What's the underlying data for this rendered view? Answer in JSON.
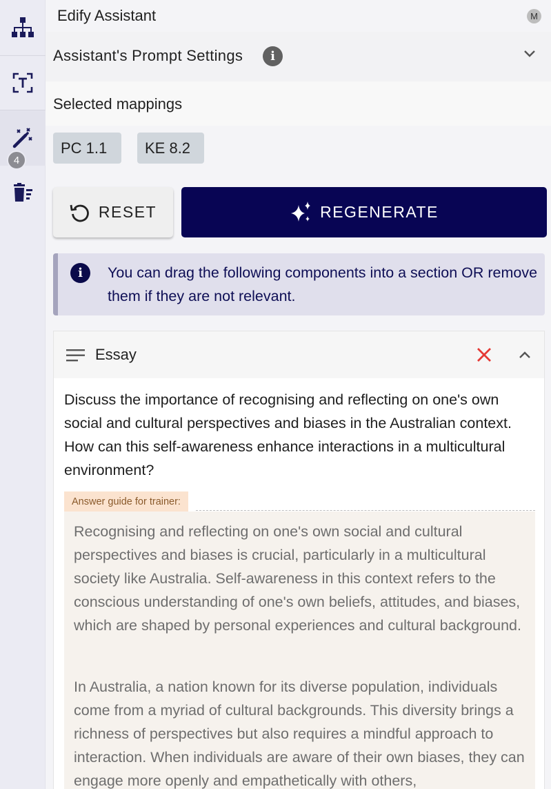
{
  "app": {
    "title": "Edify Assistant",
    "avatar_initial": "M"
  },
  "rail": {
    "badge_count": "4"
  },
  "settings": {
    "title": "Assistant's Prompt Settings"
  },
  "mappings": {
    "label": "Selected mappings",
    "chips": [
      "PC 1.1",
      "KE 8.2"
    ]
  },
  "actions": {
    "reset_label": "RESET",
    "regenerate_label": "REGENERATE"
  },
  "notice": {
    "text": "You can drag the following components into a section OR remove them if they are not relevant."
  },
  "component": {
    "title": "Essay",
    "question": "Discuss the importance of recognising and reflecting on one's own social and cultural perspectives and biases in the Australian context. How can this self-awareness enhance interactions in a multicultural environment?",
    "guide_label": "Answer guide for trainer:",
    "guide_paragraphs": [
      "Recognising and reflecting on one's own social and cultural perspectives and biases is crucial, particularly in a multicultural society like Australia. Self-awareness in this context refers to the conscious understanding of one's own beliefs, attitudes, and biases, which are shaped by personal experiences and cultural background.",
      "In Australia, a nation known for its diverse population, individuals come from a myriad of cultural backgrounds. This diversity brings a richness of perspectives but also requires a mindful approach to interaction. When individuals are aware of their own biases, they can engage more openly and empathetically with others,"
    ]
  },
  "colors": {
    "primary": "#080554",
    "danger": "#e53935",
    "chip_bg": "#d0d6dc",
    "notice_bg": "#e0dfec",
    "guide_bg": "#f6f2ed",
    "guide_tag_bg": "#fbe3cf"
  },
  "icons": [
    "sitemap-icon",
    "text-select-icon",
    "magic-wand-icon",
    "delete-list-icon",
    "info-icon",
    "chevron-down-icon",
    "refresh-icon",
    "sparkles-icon",
    "notes-lines-icon",
    "close-icon",
    "chevron-up-icon"
  ]
}
